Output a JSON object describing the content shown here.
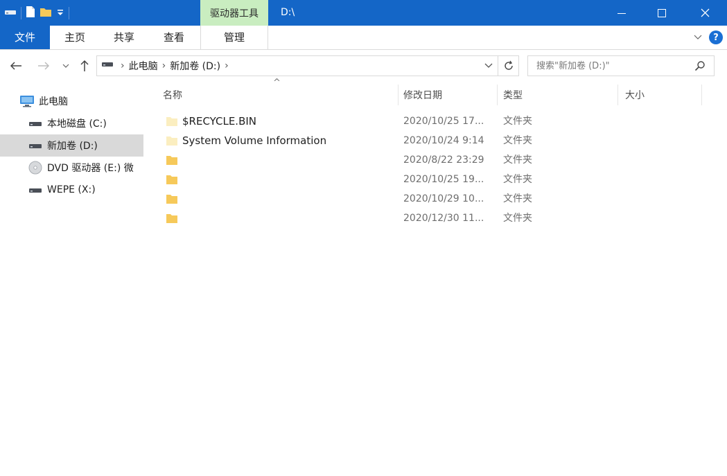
{
  "titlebar": {
    "tool_tab": "驱动器工具",
    "path_title": "D:\\"
  },
  "ribbon": {
    "tabs": [
      {
        "label": "文件"
      },
      {
        "label": "主页"
      },
      {
        "label": "共享"
      },
      {
        "label": "查看"
      },
      {
        "label": "管理"
      }
    ]
  },
  "address": {
    "crumbs": [
      "此电脑",
      "新加卷 (D:)"
    ]
  },
  "search": {
    "placeholder": "搜索\"新加卷 (D:)\""
  },
  "nav_pane": {
    "items": [
      {
        "label": "此电脑",
        "icon": "computer-icon"
      },
      {
        "label": "本地磁盘 (C:)",
        "icon": "drive-icon"
      },
      {
        "label": "新加卷 (D:)",
        "icon": "drive-icon",
        "selected": true
      },
      {
        "label": "DVD 驱动器 (E:) 微",
        "icon": "dvd-icon"
      },
      {
        "label": "WEPE (X:)",
        "icon": "drive-icon"
      }
    ]
  },
  "columns": {
    "name": "名称",
    "date": "修改日期",
    "type": "类型",
    "size": "大小"
  },
  "files": [
    {
      "name": "$RECYCLE.BIN",
      "date": "2020/10/25 17...",
      "type": "文件夹",
      "icon": "folder-faded-icon"
    },
    {
      "name": "System Volume Information",
      "date": "2020/10/24 9:14",
      "type": "文件夹",
      "icon": "folder-faded-icon"
    },
    {
      "name": "",
      "date": "2020/8/22 23:29",
      "type": "文件夹",
      "icon": "folder-icon"
    },
    {
      "name": "",
      "date": "2020/10/25 19...",
      "type": "文件夹",
      "icon": "folder-icon"
    },
    {
      "name": "",
      "date": "2020/10/29 10...",
      "type": "文件夹",
      "icon": "folder-icon"
    },
    {
      "name": "",
      "date": "2020/12/30 11...",
      "type": "文件夹",
      "icon": "folder-icon"
    }
  ],
  "colors": {
    "titlebar": "#1466c7",
    "tool_tab": "#c9edc0",
    "selection": "#d9d9d9",
    "folder": "#f6c95a"
  }
}
